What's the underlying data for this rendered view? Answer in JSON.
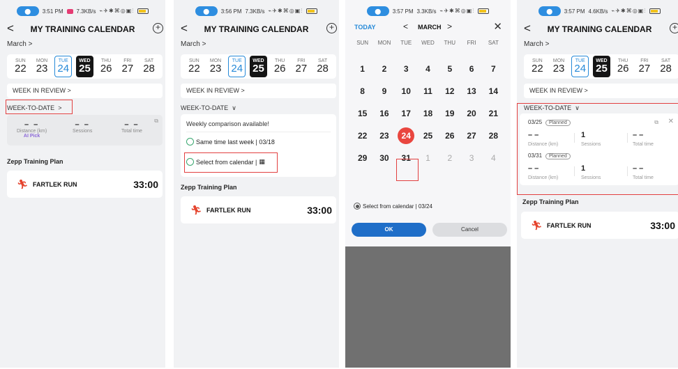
{
  "status_bar": [
    {
      "time": "3:51 PM",
      "rate": "7.3KB/s"
    },
    {
      "time": "3:56 PM",
      "rate": "7.3KB/s"
    },
    {
      "time": "3:57 PM",
      "rate": "3.3KB/s"
    },
    {
      "time": "3:57 PM",
      "rate": "4.6KB/s"
    }
  ],
  "header": {
    "title": "MY TRAINING CALENDAR",
    "back": "<",
    "add": "+"
  },
  "month_label": "March",
  "month_chevron": ">",
  "week_days": [
    {
      "name": "SUN",
      "num": "22"
    },
    {
      "name": "MON",
      "num": "23"
    },
    {
      "name": "TUE",
      "num": "24"
    },
    {
      "name": "WED",
      "num": "25"
    },
    {
      "name": "THU",
      "num": "26"
    },
    {
      "name": "FRI",
      "num": "27"
    },
    {
      "name": "SAT",
      "num": "28"
    }
  ],
  "week_in_review": "WEEK IN REVIEW >",
  "week_to_date": {
    "label": "WEEK-TO-DATE",
    "collapsed_chevron": ">",
    "expanded_chevron": "∨"
  },
  "stats_summary": {
    "distance_value": "– –",
    "distance_label": "Distance (km)",
    "ai_pick": "AI Pick",
    "sessions_value": "– –",
    "sessions_label": "Sessions",
    "time_value": "– –",
    "time_label": "Total time"
  },
  "plan": {
    "section_title": "Zepp Training Plan",
    "name": "FARTLEK RUN",
    "duration": "33:00"
  },
  "comparison": {
    "title": "Weekly comparison available!",
    "option_last_week": "Same time last week | 03/18",
    "option_calendar": "Select from calendar |"
  },
  "calendar": {
    "today_label": "TODAY",
    "month": "MARCH",
    "prev": "<",
    "next": ">",
    "close": "✕",
    "weekday_names": [
      "SUN",
      "MON",
      "TUE",
      "WED",
      "THU",
      "FRI",
      "SAT"
    ],
    "weeks": [
      [
        "1",
        "2",
        "3",
        "4",
        "5",
        "6",
        "7"
      ],
      [
        "8",
        "9",
        "10",
        "11",
        "12",
        "13",
        "14"
      ],
      [
        "15",
        "16",
        "17",
        "18",
        "19",
        "20",
        "21"
      ],
      [
        "22",
        "23",
        "24",
        "25",
        "26",
        "27",
        "28"
      ],
      [
        "29",
        "30",
        "31",
        "1",
        "2",
        "3",
        "4"
      ]
    ],
    "today_day": "24",
    "selected_day": "31",
    "selection_text": "Select from calendar | 03/24",
    "ok": "OK",
    "cancel": "Cancel"
  },
  "comparison_rows": [
    {
      "date": "03/25",
      "badge": "Planned",
      "distance": "– –",
      "distance_label": "Distance (km)",
      "sessions": "1",
      "sessions_label": "Sessions",
      "time": "– –",
      "time_label": "Total time"
    },
    {
      "date": "03/31",
      "badge": "Planned",
      "distance": "– –",
      "distance_label": "Distance (km)",
      "sessions": "1",
      "sessions_label": "Sessions",
      "time": "– –",
      "time_label": "Total time"
    }
  ]
}
